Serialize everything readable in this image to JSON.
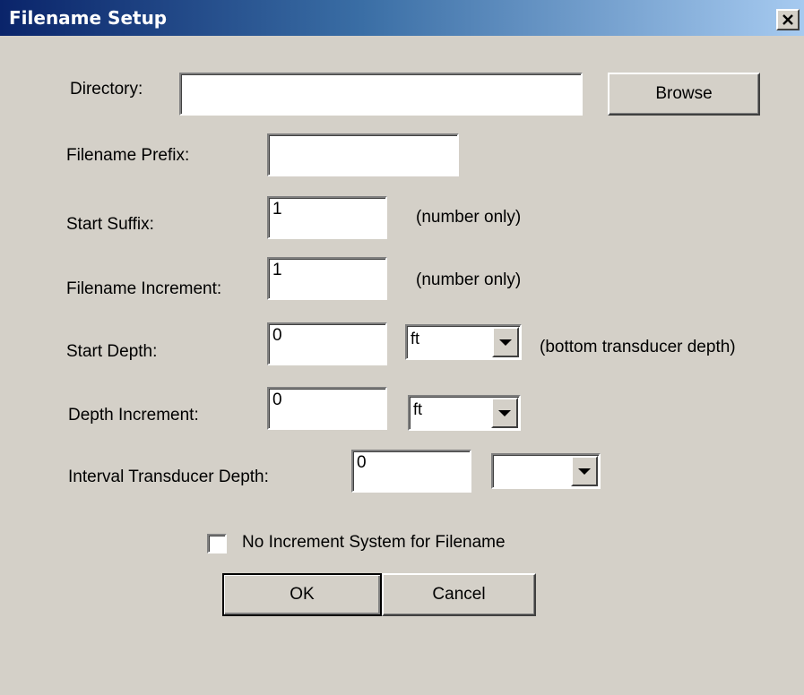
{
  "window": {
    "title": "Filename Setup",
    "close_glyph": "✕"
  },
  "fields": {
    "directory": {
      "label": "Directory:",
      "value": ""
    },
    "browse_label": "Browse",
    "filename_prefix": {
      "label": "Filename Prefix:",
      "value": ""
    },
    "start_suffix": {
      "label": "Start Suffix:",
      "value": "1",
      "hint": "(number only)"
    },
    "filename_increment": {
      "label": "Filename Increment:",
      "value": "1",
      "hint": "(number only)"
    },
    "start_depth": {
      "label": "Start Depth:",
      "value": "0",
      "unit": "ft",
      "hint": "(bottom transducer depth)"
    },
    "depth_increment": {
      "label": "Depth Increment:",
      "value": "0",
      "unit": "ft"
    },
    "interval_transducer_depth": {
      "label": "Interval Transducer Depth:",
      "value": "0",
      "unit": ""
    }
  },
  "checkbox": {
    "label": "No Increment System for Filename",
    "checked": false
  },
  "buttons": {
    "ok": "OK",
    "cancel": "Cancel"
  },
  "icons": {
    "close": "close-icon",
    "dropdown": "chevron-down-icon"
  },
  "colors": {
    "dialog_bg": "#d4d0c8",
    "title_gradient_start": "#0a246a",
    "title_gradient_end": "#a6caf0"
  }
}
